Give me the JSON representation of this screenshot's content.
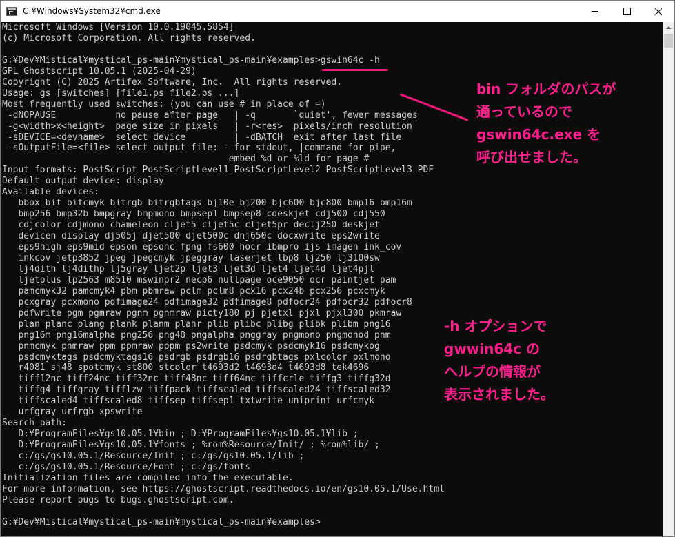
{
  "window": {
    "title": "C:¥Windows¥System32¥cmd.exe",
    "icon": "console-icon"
  },
  "console_lines": [
    "Microsoft Windows [Version 10.0.19045.5854]",
    "(c) Microsoft Corporation. All rights reserved.",
    "",
    "G:¥Dev¥Mistical¥mystical_ps-main¥mystical_ps-main¥examples>gswin64c -h",
    "GPL Ghostscript 10.05.1 (2025-04-29)",
    "Copyright (C) 2025 Artifex Software, Inc.  All rights reserved.",
    "Usage: gs [switches] [file1.ps file2.ps ...]",
    "Most frequently used switches: (you can use # in place of =)",
    " -dNOPAUSE           no pause after page   | -q       `quiet', fewer messages",
    " -g<width>x<height>  page size in pixels   | -r<res>  pixels/inch resolution",
    " -sDEVICE=<devname>  select device         | -dBATCH  exit after last file",
    " -sOutputFile=<file> select output file: - for stdout, |command for pipe,",
    "                                          embed %d or %ld for page #",
    "Input formats: PostScript PostScriptLevel1 PostScriptLevel2 PostScriptLevel3 PDF",
    "Default output device: display",
    "Available devices:",
    "   bbox bit bitcmyk bitrgb bitrgbtags bj10e bj200 bjc600 bjc800 bmp16 bmp16m",
    "   bmp256 bmp32b bmpgray bmpmono bmpsep1 bmpsep8 cdeskjet cdj500 cdj550",
    "   cdjcolor cdjmono chameleon cljet5 cljet5c cljet5pr declj250 deskjet",
    "   devicen display dj505j djet500 djet500c dnj650c docxwrite eps2write",
    "   eps9high eps9mid epson epsonc fpng fs600 hocr ibmpro ijs imagen ink_cov",
    "   inkcov jetp3852 jpeg jpegcmyk jpeggray laserjet lbp8 lj250 lj3100sw",
    "   lj4dith lj4dithp lj5gray ljet2p ljet3 ljet3d ljet4 ljet4d ljet4pjl",
    "   ljetplus lp2563 m8510 mswinpr2 necp6 nullpage oce9050 ocr paintjet pam",
    "   pamcmyk32 pamcmyk4 pbm pbmraw pclm pclm8 pcx16 pcx24b pcx256 pcxcmyk",
    "   pcxgray pcxmono pdfimage24 pdfimage32 pdfimage8 pdfocr24 pdfocr32 pdfocr8",
    "   pdfwrite pgm pgmraw pgnm pgnmraw picty180 pj pjetxl pjxl pjxl300 pkmraw",
    "   plan planc plang plank planm planr plib plibc plibg plibk plibm png16",
    "   png16m png16malpha png256 png48 pngalpha pnggray pngmono pngmonod pnm",
    "   pnmcmyk pnmraw ppm ppmraw pppm ps2write psdcmyk psdcmyk16 psdcmykog",
    "   psdcmyktags psdcmyktags16 psdrgb psdrgb16 psdrgbtags pxlcolor pxlmono",
    "   r4081 sj48 spotcmyk st800 stcolor t4693d2 t4693d4 t4693d8 tek4696",
    "   tiff12nc tiff24nc tiff32nc tiff48nc tiff64nc tiffcrle tiffg3 tiffg32d",
    "   tiffg4 tiffgray tifflzw tiffpack tiffscaled tiffscaled24 tiffscaled32",
    "   tiffscaled4 tiffscaled8 tiffsep tiffsep1 txtwrite uniprint urfcmyk",
    "   urfgray urfrgb xpswrite",
    "Search path:",
    "   D:¥ProgramFiles¥gs10.05.1¥bin ; D:¥ProgramFiles¥gs10.05.1¥lib ;",
    "   D:¥ProgramFiles¥gs10.05.1¥fonts ; %rom%Resource/Init/ ; %rom%lib/ ;",
    "   c:/gs/gs10.05.1/Resource/Init ; c:/gs/gs10.05.1/lib ;",
    "   c:/gs/gs10.05.1/Resource/Font ; c:/gs/fonts",
    "Initialization files are compiled into the executable.",
    "For more information, see https://ghostscript.readthedocs.io/en/gs10.05.1/Use.html",
    "Please report bugs to bugs.ghostscript.com.",
    "",
    "G:¥Dev¥Mistical¥mystical_ps-main¥mystical_ps-main¥examples>"
  ],
  "annotations": {
    "callout1": "bin フォルダのパスが\n通っているので\ngswin64c.exe を\n呼び出せました。",
    "callout2": "-h オプションで\ngwwin64c の\nヘルプの情報が\n表示されました。",
    "color": "#ff1d8e"
  },
  "colors": {
    "console_bg": "#0c0c0c",
    "console_fg": "#cccccc",
    "titlebar_bg": "#ffffff",
    "annotation": "#ff1d8e"
  }
}
